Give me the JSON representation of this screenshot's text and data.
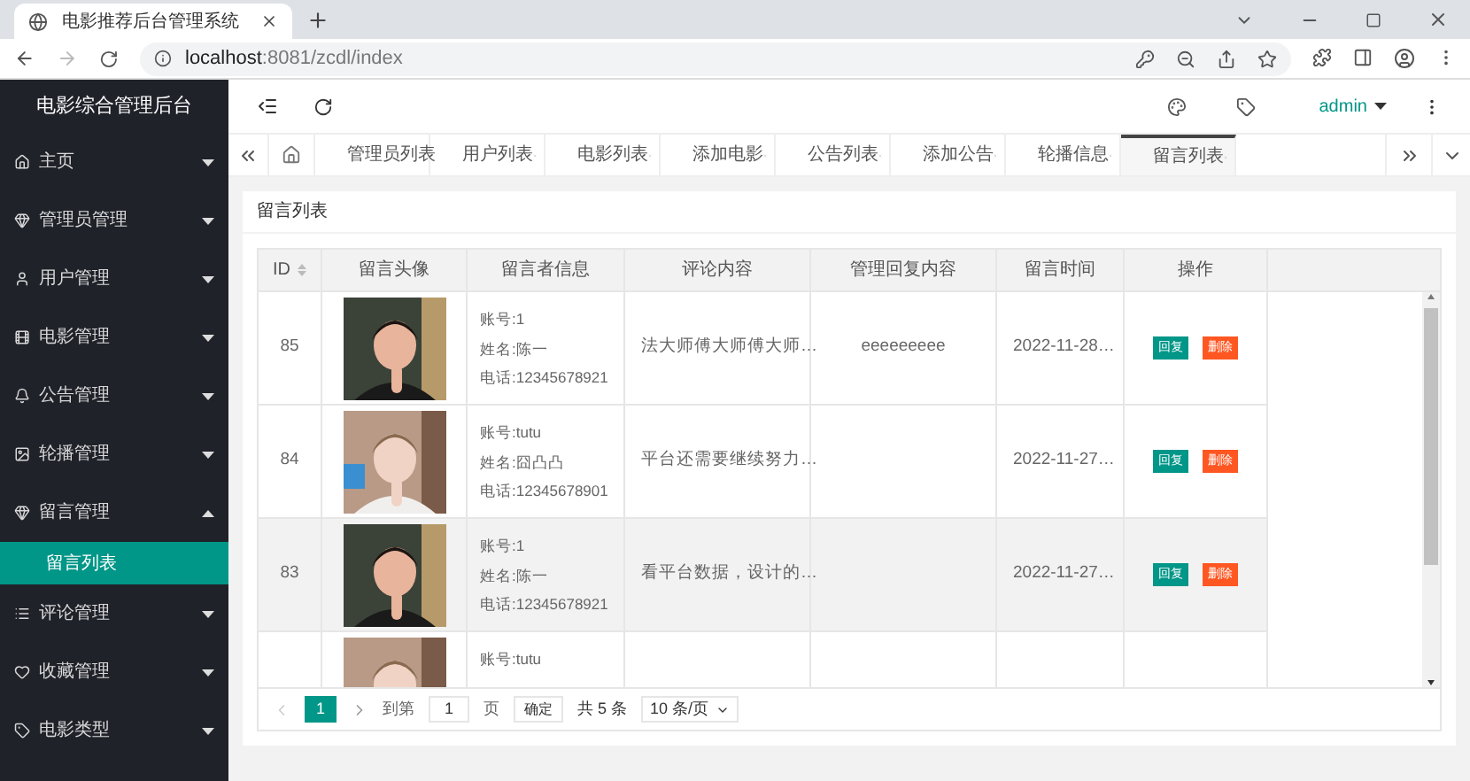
{
  "browser": {
    "tab_title": "电影推荐后台管理系统",
    "url_host": "localhost",
    "url_rest": ":8081/zcdl/index"
  },
  "sidebar": {
    "title": "电影综合管理后台",
    "items": [
      {
        "label": "主页",
        "expanded": false
      },
      {
        "label": "管理员管理",
        "expanded": false
      },
      {
        "label": "用户管理",
        "expanded": false
      },
      {
        "label": "电影管理",
        "expanded": false
      },
      {
        "label": "公告管理",
        "expanded": false
      },
      {
        "label": "轮播管理",
        "expanded": false
      },
      {
        "label": "留言管理",
        "expanded": true,
        "children": [
          {
            "label": "留言列表",
            "selected": true
          }
        ]
      },
      {
        "label": "评论管理",
        "expanded": false
      },
      {
        "label": "收藏管理",
        "expanded": false
      },
      {
        "label": "电影类型",
        "expanded": false
      }
    ]
  },
  "header": {
    "user": "admin"
  },
  "tabs": [
    {
      "label": "管理员列表",
      "selected": false
    },
    {
      "label": "用户列表",
      "selected": false
    },
    {
      "label": "电影列表",
      "selected": false
    },
    {
      "label": "添加电影",
      "selected": false
    },
    {
      "label": "公告列表",
      "selected": false
    },
    {
      "label": "添加公告",
      "selected": false
    },
    {
      "label": "轮播信息",
      "selected": false
    },
    {
      "label": "留言列表",
      "selected": true
    }
  ],
  "card": {
    "title": "留言列表"
  },
  "table": {
    "columns": [
      "ID",
      "留言头像",
      "留言者信息",
      "评论内容",
      "管理回复内容",
      "留言时间",
      "操作"
    ],
    "rows": [
      {
        "id": "85",
        "info": [
          "账号:1",
          "姓名:陈一",
          "电话:12345678921"
        ],
        "comment": "法大师傅大师傅大师…",
        "reply": "eeeeeeeee",
        "time": "2022-11-28…",
        "actions": [
          "回复",
          "删除"
        ],
        "hovered": false
      },
      {
        "id": "84",
        "info": [
          "账号:tutu",
          "姓名:囧凸凸",
          "电话:12345678901"
        ],
        "comment": "平台还需要继续努力…",
        "time": "2022-11-27…",
        "actions": [
          "回复",
          "删除"
        ],
        "hovered": false
      },
      {
        "id": "83",
        "info": [
          "账号:1",
          "姓名:陈一",
          "电话:12345678921"
        ],
        "comment": "看平台数据，设计的…",
        "time": "2022-11-27…",
        "actions": [
          "回复",
          "删除"
        ],
        "hovered": true
      },
      {
        "info": [
          "账号:tutu"
        ],
        "hovered": false
      }
    ]
  },
  "pagination": {
    "current": "1",
    "goto_label": "到第",
    "goto_value": "1",
    "page_unit": "页",
    "confirm": "确定",
    "total": "共 5 条",
    "page_size": "10 条/页"
  }
}
